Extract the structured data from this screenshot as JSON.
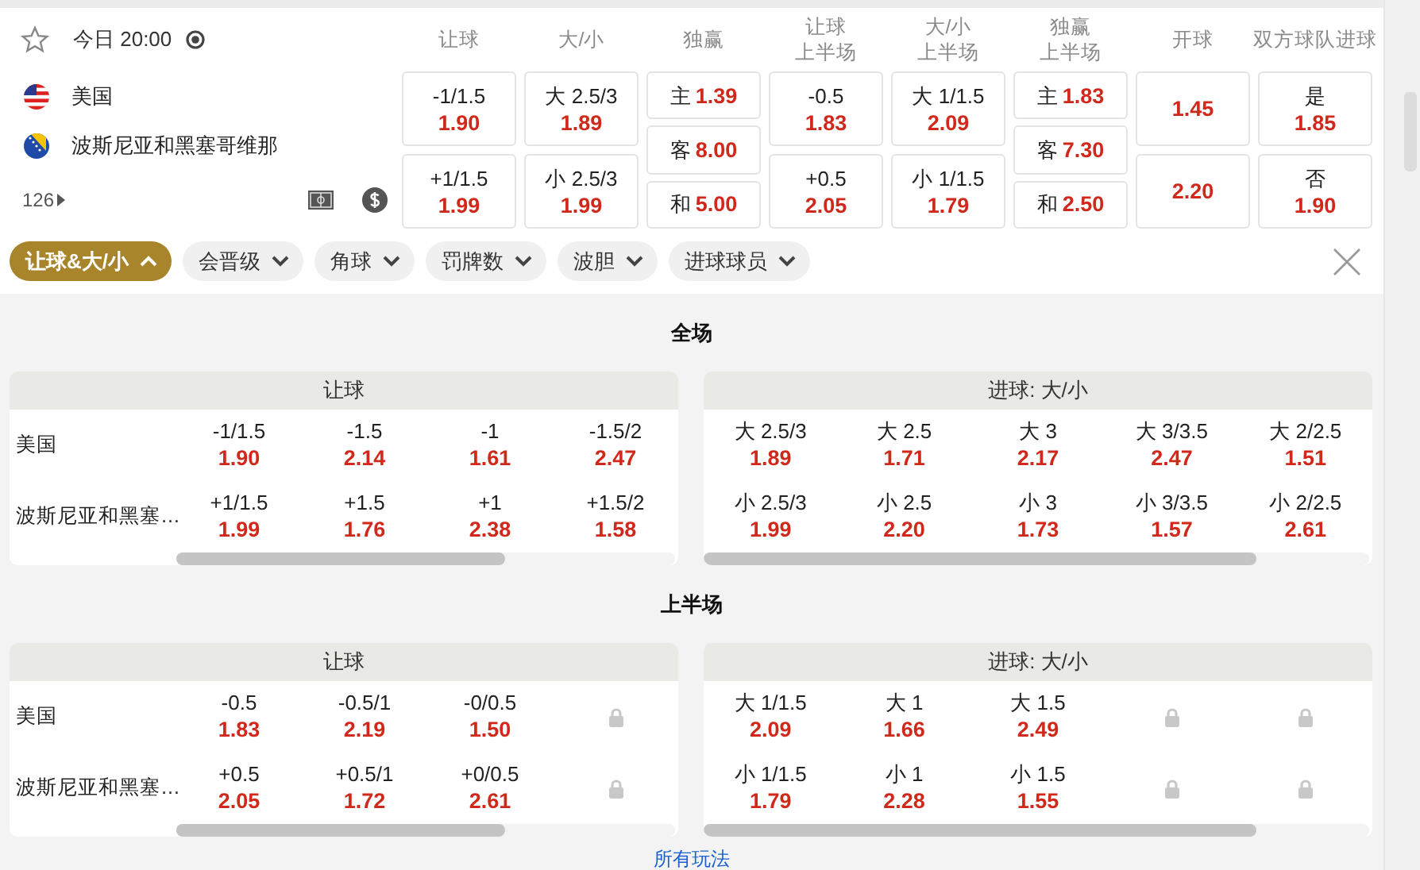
{
  "header": {
    "time": "今日 20:00",
    "market_count": "126"
  },
  "teams": [
    {
      "name": "美国",
      "kind": "us"
    },
    {
      "name": "波斯尼亚和黑塞哥维那",
      "kind": "ba"
    }
  ],
  "markets": [
    {
      "label": "让球",
      "kind": "stacked",
      "cells": [
        {
          "line": "-1/1.5",
          "odds": "1.90"
        },
        {
          "line": "+1/1.5",
          "odds": "1.99"
        }
      ]
    },
    {
      "label": "大/小",
      "kind": "stacked",
      "cells": [
        {
          "line": "大 2.5/3",
          "odds": "1.89"
        },
        {
          "line": "小 2.5/3",
          "odds": "1.99"
        }
      ]
    },
    {
      "label": "独赢",
      "kind": "inline",
      "cells": [
        {
          "line": "主",
          "odds": "1.39"
        },
        {
          "line": "客",
          "odds": "8.00"
        },
        {
          "line": "和",
          "odds": "5.00"
        }
      ]
    },
    {
      "label": "让球",
      "sublabel": "上半场",
      "kind": "stacked",
      "cells": [
        {
          "line": "-0.5",
          "odds": "1.83"
        },
        {
          "line": "+0.5",
          "odds": "2.05"
        }
      ]
    },
    {
      "label": "大/小",
      "sublabel": "上半场",
      "kind": "stacked",
      "cells": [
        {
          "line": "大 1/1.5",
          "odds": "2.09"
        },
        {
          "line": "小 1/1.5",
          "odds": "1.79"
        }
      ]
    },
    {
      "label": "独赢",
      "sublabel": "上半场",
      "kind": "inline",
      "cells": [
        {
          "line": "主",
          "odds": "1.83"
        },
        {
          "line": "客",
          "odds": "7.30"
        },
        {
          "line": "和",
          "odds": "2.50"
        }
      ]
    },
    {
      "label": "开球",
      "kind": "odds",
      "cells": [
        {
          "odds": "1.45"
        },
        {
          "odds": "2.20"
        }
      ]
    },
    {
      "label": "双方球队进球",
      "kind": "stacked",
      "cells": [
        {
          "line": "是",
          "odds": "1.85"
        },
        {
          "line": "否",
          "odds": "1.90"
        }
      ]
    }
  ],
  "filters": [
    {
      "label": "让球&大/小",
      "selected": true
    },
    {
      "label": "会晋级",
      "selected": false
    },
    {
      "label": "角球",
      "selected": false
    },
    {
      "label": "罚牌数",
      "selected": false
    },
    {
      "label": "波胆",
      "selected": false
    },
    {
      "label": "进球球员",
      "selected": false
    }
  ],
  "sections": [
    {
      "title": "全场",
      "panels": [
        {
          "title": "让球",
          "rows": [
            {
              "team": "美国",
              "cells": [
                {
                  "locked": false,
                  "line": "-1/1.5",
                  "odds": "1.90"
                },
                {
                  "locked": false,
                  "line": "-1.5",
                  "odds": "2.14"
                },
                {
                  "locked": false,
                  "line": "-1",
                  "odds": "1.61"
                },
                {
                  "locked": false,
                  "line": "-1.5/2",
                  "odds": "2.47"
                }
              ]
            },
            {
              "team": "波斯尼亚和黑塞…",
              "cells": [
                {
                  "locked": false,
                  "line": "+1/1.5",
                  "odds": "1.99"
                },
                {
                  "locked": false,
                  "line": "+1.5",
                  "odds": "1.76"
                },
                {
                  "locked": false,
                  "line": "+1",
                  "odds": "2.38"
                },
                {
                  "locked": false,
                  "line": "+1.5/2",
                  "odds": "1.58"
                }
              ]
            }
          ]
        },
        {
          "title": "进球: 大/小",
          "rows": [
            {
              "cells": [
                {
                  "locked": false,
                  "line": "大 2.5/3",
                  "odds": "1.89"
                },
                {
                  "locked": false,
                  "line": "大 2.5",
                  "odds": "1.71"
                },
                {
                  "locked": false,
                  "line": "大 3",
                  "odds": "2.17"
                },
                {
                  "locked": false,
                  "line": "大 3/3.5",
                  "odds": "2.47"
                },
                {
                  "locked": false,
                  "line": "大 2/2.5",
                  "odds": "1.51"
                }
              ]
            },
            {
              "cells": [
                {
                  "locked": false,
                  "line": "小 2.5/3",
                  "odds": "1.99"
                },
                {
                  "locked": false,
                  "line": "小 2.5",
                  "odds": "2.20"
                },
                {
                  "locked": false,
                  "line": "小 3",
                  "odds": "1.73"
                },
                {
                  "locked": false,
                  "line": "小 3/3.5",
                  "odds": "1.57"
                },
                {
                  "locked": false,
                  "line": "小 2/2.5",
                  "odds": "2.61"
                }
              ]
            }
          ]
        }
      ]
    },
    {
      "title": "上半场",
      "panels": [
        {
          "title": "让球",
          "rows": [
            {
              "team": "美国",
              "cells": [
                {
                  "locked": false,
                  "line": "-0.5",
                  "odds": "1.83"
                },
                {
                  "locked": false,
                  "line": "-0.5/1",
                  "odds": "2.19"
                },
                {
                  "locked": false,
                  "line": "-0/0.5",
                  "odds": "1.50"
                },
                {
                  "locked": true
                }
              ]
            },
            {
              "team": "波斯尼亚和黑塞…",
              "cells": [
                {
                  "locked": false,
                  "line": "+0.5",
                  "odds": "2.05"
                },
                {
                  "locked": false,
                  "line": "+0.5/1",
                  "odds": "1.72"
                },
                {
                  "locked": false,
                  "line": "+0/0.5",
                  "odds": "2.61"
                },
                {
                  "locked": true
                }
              ]
            }
          ]
        },
        {
          "title": "进球: 大/小",
          "rows": [
            {
              "cells": [
                {
                  "locked": false,
                  "line": "大 1/1.5",
                  "odds": "2.09"
                },
                {
                  "locked": false,
                  "line": "大 1",
                  "odds": "1.66"
                },
                {
                  "locked": false,
                  "line": "大 1.5",
                  "odds": "2.49"
                },
                {
                  "locked": true
                },
                {
                  "locked": true
                }
              ]
            },
            {
              "cells": [
                {
                  "locked": false,
                  "line": "小 1/1.5",
                  "odds": "1.79"
                },
                {
                  "locked": false,
                  "line": "小 1",
                  "odds": "2.28"
                },
                {
                  "locked": false,
                  "line": "小 1.5",
                  "odds": "1.55"
                },
                {
                  "locked": true
                },
                {
                  "locked": true
                }
              ]
            }
          ]
        }
      ]
    }
  ],
  "footer_link": "所有玩法"
}
